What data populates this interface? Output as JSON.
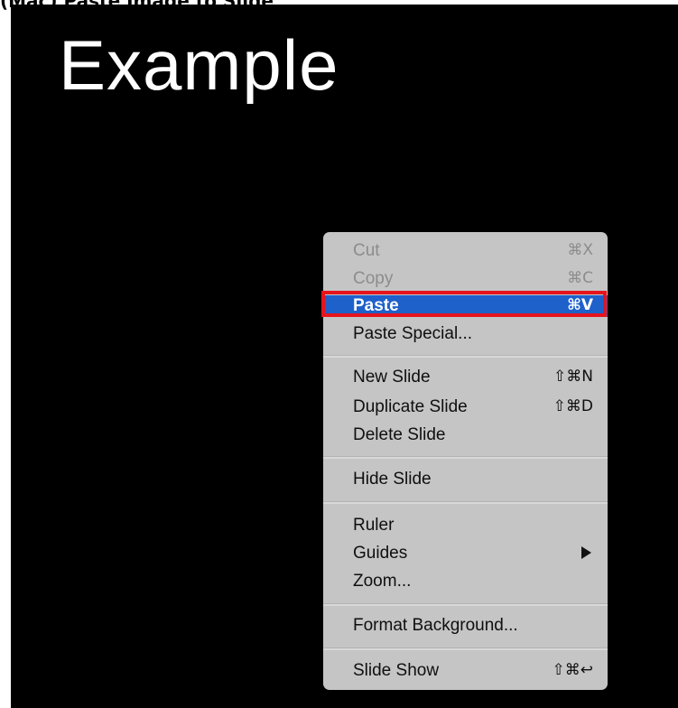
{
  "caption": "(Mac) Paste Image to Slide",
  "slide": {
    "title": "Example"
  },
  "menu": {
    "items": [
      {
        "label": "Cut",
        "shortcut": "⌘X",
        "state": "disabled"
      },
      {
        "label": "Copy",
        "shortcut": "⌘C",
        "state": "disabled"
      },
      {
        "label": "Paste",
        "shortcut": "⌘V",
        "state": "highlighted"
      },
      {
        "label": "Paste Special...",
        "shortcut": "",
        "state": "enabled"
      },
      {
        "label": "New Slide",
        "shortcut": "⇧⌘N",
        "state": "enabled"
      },
      {
        "label": "Duplicate Slide",
        "shortcut": "⇧⌘D",
        "state": "enabled"
      },
      {
        "label": "Delete Slide",
        "shortcut": "",
        "state": "enabled"
      },
      {
        "label": "Hide Slide",
        "shortcut": "",
        "state": "enabled"
      },
      {
        "label": "Ruler",
        "shortcut": "",
        "state": "enabled"
      },
      {
        "label": "Guides",
        "shortcut": "",
        "state": "enabled",
        "submenu": true
      },
      {
        "label": "Zoom...",
        "shortcut": "",
        "state": "enabled"
      },
      {
        "label": "Format Background...",
        "shortcut": "",
        "state": "enabled"
      },
      {
        "label": "Slide Show",
        "shortcut": "⇧⌘↩",
        "state": "enabled"
      }
    ]
  },
  "colors": {
    "slide_background": "#000000",
    "menu_background": "#c5c5c5",
    "selection_blue": "#1e61cb",
    "annotation_red": "#e6141d",
    "disabled_text": "#8c8c8c"
  },
  "icons": {
    "submenu_indicator": "triangle-right-icon"
  }
}
